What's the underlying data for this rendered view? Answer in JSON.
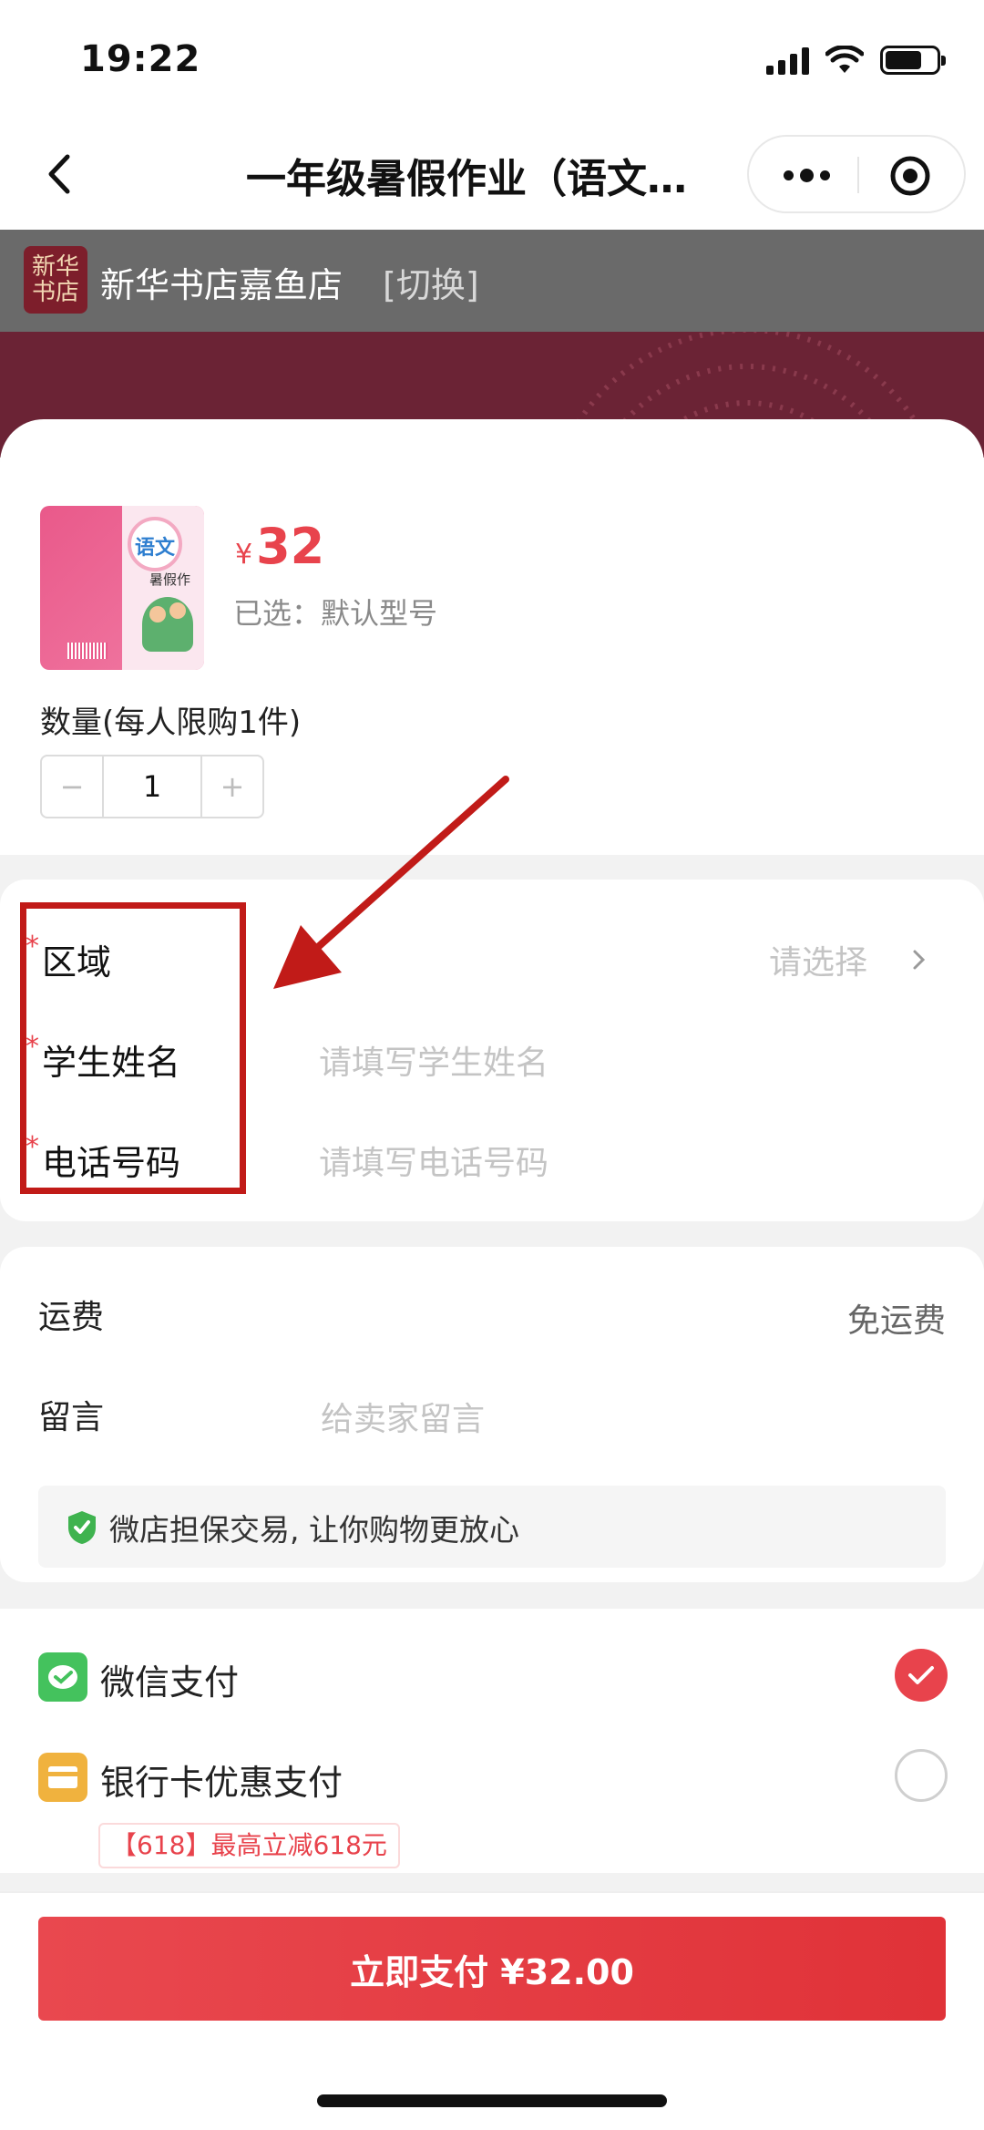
{
  "status_bar": {
    "time": "19:22"
  },
  "nav": {
    "title": "一年级暑假作业（语文…"
  },
  "store": {
    "logo_text": "新华书店",
    "name": "新华书店嘉鱼店",
    "switch_label": "[切换]"
  },
  "product": {
    "price_symbol": "¥",
    "price": "32",
    "selected_spec": "已选：默认型号",
    "quantity_label": "数量(每人限购1件)",
    "quantity": "1",
    "minus": "−",
    "plus": "+",
    "cover": {
      "title": "语文",
      "subtitle": "暑假作"
    }
  },
  "form": {
    "required_mark": "*",
    "region_label": "区域",
    "region_placeholder": "请选择",
    "student_label": "学生姓名",
    "student_placeholder": "请填写学生姓名",
    "phone_label": "电话号码",
    "phone_placeholder": "请填写电话号码"
  },
  "shipping": {
    "freight_label": "运费",
    "freight_value": "免运费",
    "message_label": "留言",
    "message_placeholder": "给卖家留言",
    "guarantee_text": "微店担保交易, 让你购物更放心"
  },
  "payment": {
    "options": [
      {
        "label": "微信支付",
        "selected": true,
        "icon": "wechat-pay-icon"
      },
      {
        "label": "银行卡优惠支付",
        "selected": false,
        "icon": "bank-card-icon"
      }
    ],
    "promo": "【618】最高立减618元"
  },
  "bottom": {
    "pay_button": "立即支付 ¥32.00"
  },
  "colors": {
    "accent": "#e8434c",
    "annotation": "#c11b18",
    "banner": "#6b2335"
  }
}
